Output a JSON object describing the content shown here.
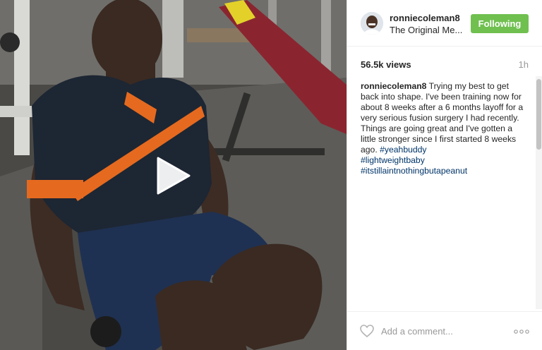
{
  "video": {
    "play_icon": "play-icon"
  },
  "header": {
    "username": "ronniecoleman8",
    "location": "The Original Me...",
    "follow_label": "Following",
    "follow_color": "#70c050"
  },
  "stats": {
    "views": "56.5k views",
    "timestamp": "1h"
  },
  "caption": {
    "username": "ronniecoleman8",
    "text": " Trying my best to get back into shape. I've been training now for about 8 weeks after a 6 months layoff for a very serious fusion surgery I had recently. Things are going great and I've gotten a little stronger since I first started 8 weeks ago. ",
    "hashtags": [
      "#yeahbuddy",
      "#lightweightbaby",
      "#itstillaintnothingbutapeanut"
    ],
    "hashtag_color": "#003569"
  },
  "footer": {
    "comment_placeholder": "Add a comment...",
    "like_icon": "heart-icon",
    "more_icon": "more-options-icon"
  }
}
